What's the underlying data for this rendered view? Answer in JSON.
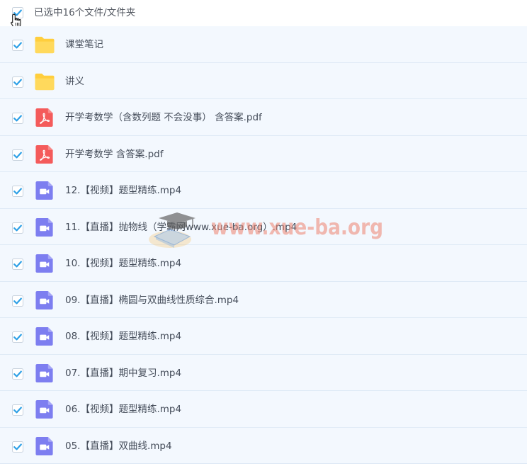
{
  "header": {
    "selection_label": "已选中16个文件/文件夹",
    "select_all_checked": true
  },
  "colors": {
    "checkbox_blue": "#2ea0e6",
    "folder_yellow": "#ffce3d",
    "pdf_red": "#f45b5b",
    "video_purple": "#7d7ef0",
    "row_bg": "#f3f8fe",
    "row_border": "#dfeaf6",
    "text": "#454d5a",
    "watermark_text": "#ec826e"
  },
  "files": [
    {
      "name": "课堂笔记",
      "type": "folder",
      "icon": "folder-icon",
      "checked": true
    },
    {
      "name": "讲义",
      "type": "folder",
      "icon": "folder-icon",
      "checked": true
    },
    {
      "name": "开学考数学（含数列题 不会没事） 含答案.pdf",
      "type": "pdf",
      "icon": "pdf-icon",
      "checked": true
    },
    {
      "name": "开学考数学 含答案.pdf",
      "type": "pdf",
      "icon": "pdf-icon",
      "checked": true
    },
    {
      "name": "12.【视频】题型精练.mp4",
      "type": "video",
      "icon": "video-icon",
      "checked": true
    },
    {
      "name": "11.【直播】抛物线（学霸网www.xue-ba.org）.mp4",
      "type": "video",
      "icon": "video-icon",
      "checked": true
    },
    {
      "name": "10.【视频】题型精练.mp4",
      "type": "video",
      "icon": "video-icon",
      "checked": true
    },
    {
      "name": "09.【直播】椭圆与双曲线性质综合.mp4",
      "type": "video",
      "icon": "video-icon",
      "checked": true
    },
    {
      "name": "08.【视频】题型精练.mp4",
      "type": "video",
      "icon": "video-icon",
      "checked": true
    },
    {
      "name": "07.【直播】期中复习.mp4",
      "type": "video",
      "icon": "video-icon",
      "checked": true
    },
    {
      "name": "06.【视频】题型精练.mp4",
      "type": "video",
      "icon": "video-icon",
      "checked": true
    },
    {
      "name": "05.【直播】双曲线.mp4",
      "type": "video",
      "icon": "video-icon",
      "checked": true
    }
  ],
  "watermark": {
    "text": "www.xue-ba.org"
  }
}
